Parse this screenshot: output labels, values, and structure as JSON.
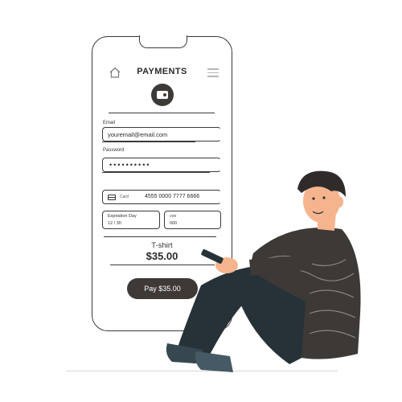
{
  "header": {
    "title": "PAYMENTS",
    "home_icon": "home-icon",
    "menu_icon": "hamburger-menu-icon"
  },
  "logo": {
    "icon": "wallet-icon"
  },
  "form": {
    "email_label": "Email",
    "email_value": "youremail@email.com",
    "password_label": "Password",
    "password_value": "••••••••••",
    "card_label": "Card",
    "card_number": "4555 0000 7777 6666",
    "expiration_label": "Expiration Day",
    "expiration_value": "12 / 30",
    "cvv_label": "cvv",
    "cvv_value": "000"
  },
  "order": {
    "product": "T-shirt",
    "price": "$35.00"
  },
  "pay_button": {
    "label": "Pay $35.00"
  },
  "colors": {
    "accent": "#3d3936",
    "outline": "#3a3a3a",
    "skin": "#f6b48e",
    "hair": "#2f2b2b",
    "pants": "#263238"
  }
}
